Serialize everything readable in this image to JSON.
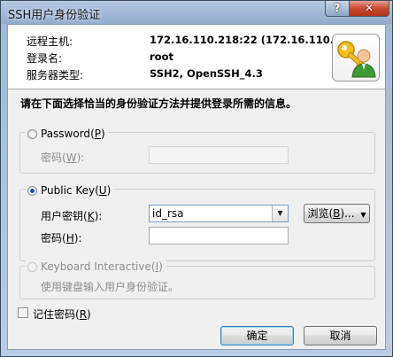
{
  "window": {
    "title": "SSH用户身份验证",
    "help_label": "?",
    "close_label": "✕"
  },
  "info": {
    "host_label": "远程主机:",
    "host_value": "172.16.110.218:22 (172.16.110.218",
    "login_label": "登录名:",
    "login_value": "root",
    "server_type_label": "服务器类型:",
    "server_type_value": "SSH2, OpenSSH_4.3"
  },
  "instruction": "请在下面选择恰当的身份验证方法并提供登录所需的信息。",
  "password_group": {
    "label": "Password",
    "mnemonic": "P",
    "selected": false,
    "field_label": "密码",
    "field_mnemonic": "W",
    "field_value": ""
  },
  "publickey_group": {
    "label": "Public Key",
    "mnemonic": "U",
    "selected": true,
    "key_label": "用户密钥",
    "key_mnemonic": "K",
    "key_value": "id_rsa",
    "browse_label": "浏览",
    "browse_mnemonic": "B",
    "browse_suffix": "...",
    "pass_label": "密码",
    "pass_mnemonic": "H",
    "pass_value": ""
  },
  "keyboard_group": {
    "label": "Keyboard Interactive",
    "mnemonic": "I",
    "selected": false,
    "description": "使用键盘输入用户身份验证。"
  },
  "remember": {
    "label": "记住密码",
    "mnemonic": "R",
    "checked": false
  },
  "buttons": {
    "ok_label": "确定",
    "cancel_label": "取消"
  },
  "colors": {
    "title_bar": "#a3b9d6",
    "close_button": "#c74a30",
    "radio_dot": "#1f4fb0"
  }
}
